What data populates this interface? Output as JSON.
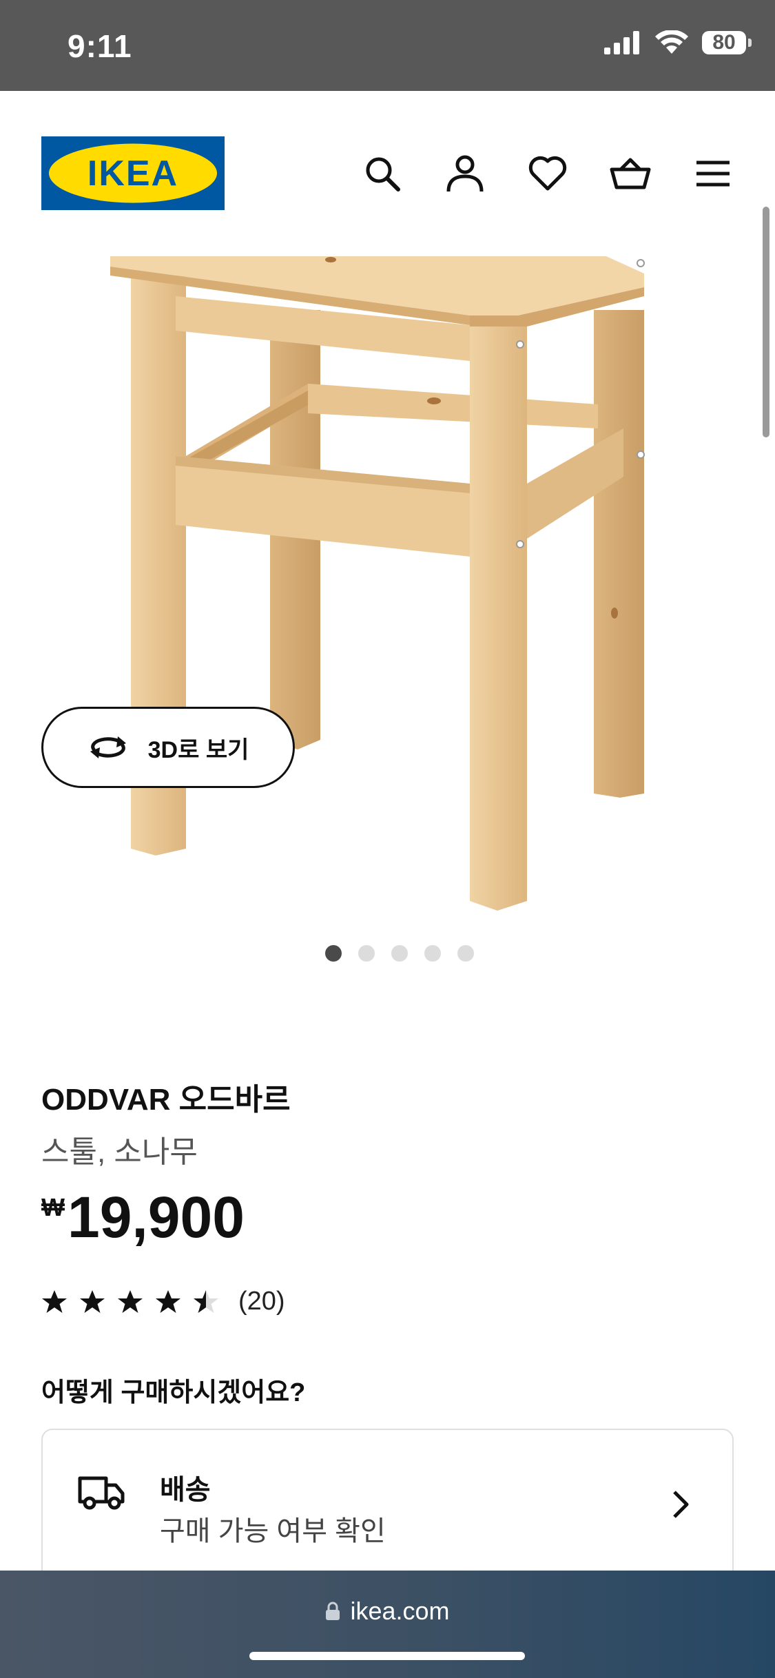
{
  "status_bar": {
    "time": "9:11",
    "battery": "80"
  },
  "header": {
    "logo_text": "IKEA",
    "icons": [
      "search-icon",
      "user-icon",
      "heart-icon",
      "basket-icon",
      "menu-icon"
    ]
  },
  "gallery": {
    "view_3d_label": "3D로 보기",
    "dots_count": 5,
    "active_dot": 1
  },
  "product": {
    "name": "ODDVAR 오드바르",
    "description": "스툴, 소나무",
    "price_currency": "₩",
    "price_value": "19,900",
    "rating_value": 4.5,
    "rating_max": 5,
    "review_count": "(20)"
  },
  "purchase": {
    "heading": "어떻게 구매하시겠어요?",
    "delivery_title": "배송",
    "delivery_subtitle": "구매 가능 여부 확인"
  },
  "browser": {
    "url": "ikea.com"
  },
  "colors": {
    "ikea_blue": "#0058a3",
    "ikea_yellow": "#ffdb00",
    "wood": "#e6c38e"
  }
}
